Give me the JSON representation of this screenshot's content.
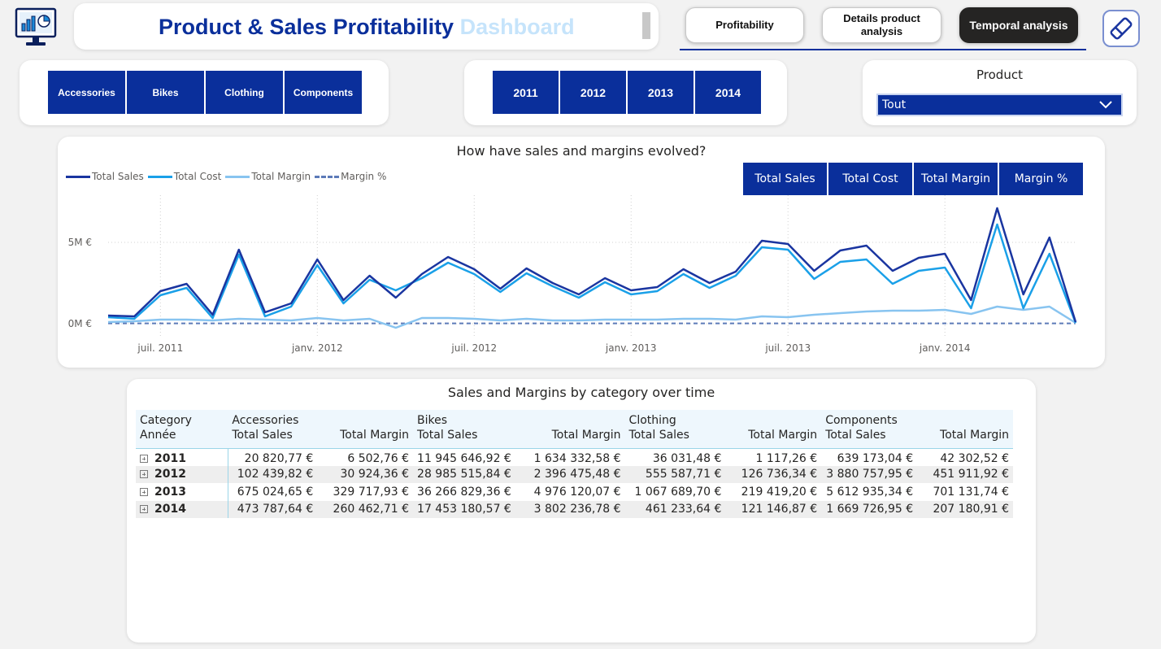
{
  "header": {
    "title_main": "Product & Sales Profitability",
    "title_accent": "Dashboard"
  },
  "nav": {
    "tabs": [
      {
        "label": "Profitability",
        "active": false
      },
      {
        "label": "Details product analysis",
        "active": false
      },
      {
        "label": "Temporal analysis",
        "active": true
      }
    ]
  },
  "icons": {
    "logo": "dashboard-monitor-icon",
    "clear_filters": "eraser-icon",
    "dropdown": "chevron-down-icon",
    "expand_row": "expand-plus-icon"
  },
  "colors": {
    "brand": "#0a2f9b",
    "total_sales": "#1a35a0",
    "total_cost": "#1aa0e8",
    "total_margin": "#88c4f0",
    "margin_pct": "#5c7ab8",
    "title_accent": "#c6e4fb"
  },
  "category_slicer": {
    "items": [
      "Accessories",
      "Bikes",
      "Clothing",
      "Components"
    ]
  },
  "year_slicer": {
    "items": [
      "2011",
      "2012",
      "2013",
      "2014"
    ]
  },
  "product_slicer": {
    "label": "Product",
    "selected": "Tout"
  },
  "chart_data": {
    "type": "line",
    "title": "How have sales and margins evolved?",
    "x": [
      "2011-05",
      "2011-06",
      "2011-07",
      "2011-08",
      "2011-09",
      "2011-10",
      "2011-11",
      "2011-12",
      "2012-01",
      "2012-02",
      "2012-03",
      "2012-04",
      "2012-05",
      "2012-06",
      "2012-07",
      "2012-08",
      "2012-09",
      "2012-10",
      "2012-11",
      "2012-12",
      "2013-01",
      "2013-02",
      "2013-03",
      "2013-04",
      "2013-05",
      "2013-06",
      "2013-07",
      "2013-08",
      "2013-09",
      "2013-10",
      "2013-11",
      "2013-12",
      "2014-01",
      "2014-02",
      "2014-03",
      "2014-04",
      "2014-05",
      "2014-06"
    ],
    "x_ticks": [
      "juil. 2011",
      "janv. 2012",
      "juil. 2012",
      "janv. 2013",
      "juil. 2013",
      "janv. 2014"
    ],
    "x_tick_values": [
      "2011-07",
      "2012-01",
      "2012-07",
      "2013-01",
      "2013-07",
      "2014-01"
    ],
    "y_ticks": [
      "0M €",
      "5M €"
    ],
    "y_tick_values": [
      0,
      5
    ],
    "y_unit": "M €",
    "ylim": [
      -0.5,
      7.5
    ],
    "grid": true,
    "legend": "top-left",
    "series": [
      {
        "name": "Total Sales",
        "style": "solid",
        "values": [
          0.5,
          0.45,
          2.0,
          2.45,
          0.55,
          4.55,
          0.7,
          1.25,
          3.95,
          1.45,
          2.95,
          1.6,
          3.05,
          4.1,
          3.35,
          2.15,
          3.4,
          2.5,
          1.8,
          2.8,
          2.05,
          2.25,
          3.35,
          2.5,
          3.2,
          5.1,
          4.9,
          3.25,
          4.5,
          4.8,
          3.25,
          4.05,
          4.3,
          1.45,
          7.1,
          1.8,
          5.3,
          0.1
        ]
      },
      {
        "name": "Total Cost",
        "style": "solid",
        "values": [
          0.4,
          0.3,
          1.75,
          2.2,
          0.35,
          4.25,
          0.45,
          1.05,
          3.6,
          1.25,
          2.7,
          2.05,
          2.8,
          3.75,
          3.05,
          1.95,
          3.1,
          2.3,
          1.6,
          2.55,
          1.8,
          2.0,
          3.05,
          2.2,
          2.95,
          4.7,
          4.55,
          2.75,
          3.8,
          3.95,
          2.45,
          3.25,
          3.45,
          0.95,
          6.1,
          0.95,
          4.3,
          0.05
        ]
      },
      {
        "name": "Total Margin",
        "style": "solid",
        "values": [
          0.1,
          0.15,
          0.25,
          0.25,
          0.2,
          0.3,
          0.25,
          0.2,
          0.35,
          0.2,
          0.3,
          -0.25,
          0.35,
          0.35,
          0.3,
          0.2,
          0.3,
          0.2,
          0.2,
          0.25,
          0.25,
          0.25,
          0.3,
          0.3,
          0.25,
          0.45,
          0.4,
          0.55,
          0.65,
          0.75,
          0.8,
          0.8,
          0.85,
          0.6,
          1.05,
          0.85,
          1.05,
          0.05
        ]
      },
      {
        "name": "Margin %",
        "style": "dashed",
        "values": [
          0.02,
          0.02,
          0.02,
          0.02,
          0.02,
          0.02,
          0.02,
          0.02,
          0.02,
          0.02,
          0.02,
          0.02,
          0.02,
          0.02,
          0.02,
          0.02,
          0.02,
          0.02,
          0.02,
          0.02,
          0.02,
          0.02,
          0.02,
          0.02,
          0.02,
          0.02,
          0.02,
          0.02,
          0.02,
          0.02,
          0.02,
          0.02,
          0.02,
          0.02,
          0.02,
          0.02,
          0.02,
          0.02
        ]
      }
    ]
  },
  "metric_buttons": [
    "Total Sales",
    "Total Cost",
    "Total Margin",
    "Margin %"
  ],
  "matrix": {
    "title": "Sales and Margins by category over time",
    "row_header_1": "Category",
    "row_header_2": "Année",
    "categories": [
      "Accessories",
      "Bikes",
      "Clothing",
      "Components"
    ],
    "measures": [
      "Total Sales",
      "Total Margin"
    ],
    "rows": [
      {
        "year": "2011",
        "cells": [
          "20 820,77 €",
          "6 502,76 €",
          "11 945 646,92 €",
          "1 634 332,58 €",
          "36 031,48 €",
          "1 117,26 €",
          "639 173,04 €",
          "42 302,52 €"
        ]
      },
      {
        "year": "2012",
        "cells": [
          "102 439,82 €",
          "30 924,36 €",
          "28 985 515,84 €",
          "2 396 475,48 €",
          "555 587,71 €",
          "126 736,34 €",
          "3 880 757,95 €",
          "451 911,92 €"
        ]
      },
      {
        "year": "2013",
        "cells": [
          "675 024,65 €",
          "329 717,93 €",
          "36 266 829,36 €",
          "4 976 120,07 €",
          "1 067 689,70 €",
          "219 419,20 €",
          "5 612 935,34 €",
          "701 131,74 €"
        ]
      },
      {
        "year": "2014",
        "cells": [
          "473 787,64 €",
          "260 462,71 €",
          "17 453 180,57 €",
          "3 802 236,78 €",
          "461 233,64 €",
          "121 146,87 €",
          "1 669 726,95 €",
          "207 180,91 €"
        ]
      }
    ]
  }
}
